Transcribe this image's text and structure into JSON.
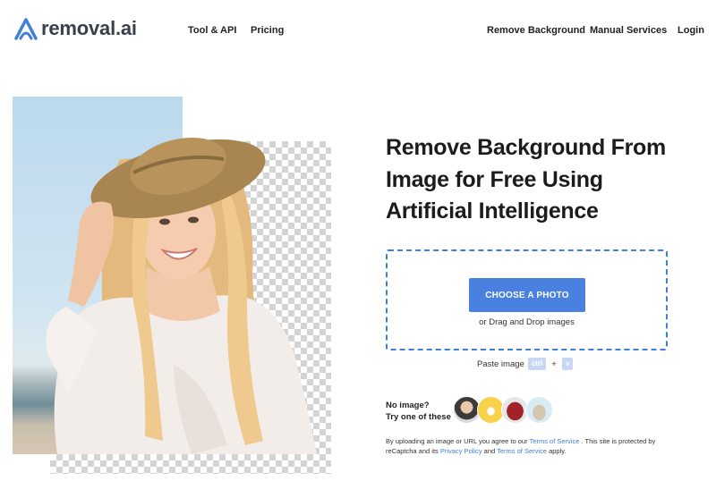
{
  "header": {
    "logo_text": "removal.ai",
    "nav_left": [
      "Tool & API",
      "Pricing"
    ],
    "nav_right": [
      "Remove Background",
      "Manual Services",
      "Login"
    ]
  },
  "hero": {
    "headline_lines": [
      "Remove Background From",
      "Image for Free Using",
      "Artificial Intelligence"
    ]
  },
  "upload": {
    "button_label": "CHOOSE A PHOTO",
    "drag_text": "or Drag and Drop images",
    "paste_label": "Paste image",
    "key_ctrl": "ctrl",
    "key_plus": "+",
    "key_v": "v"
  },
  "samples": {
    "label_line1": "No image?",
    "label_line2": "Try one of these",
    "items": [
      "person-sample",
      "car-sample",
      "bag-sample",
      "animal-sample"
    ]
  },
  "legal": {
    "text1": "By uploading an image or URL you agree to our",
    "link_terms": "Terms of Service",
    "text2": ". This site is protected by reCaptcha and its",
    "link_privacy": "Privacy Policy",
    "text3": "and",
    "link_terms2": "Terms of Service",
    "text4": "apply."
  },
  "colors": {
    "accent": "#4a80e0",
    "dashed_border": "#3f7fdc",
    "key_bg": "#c7d7f4"
  }
}
